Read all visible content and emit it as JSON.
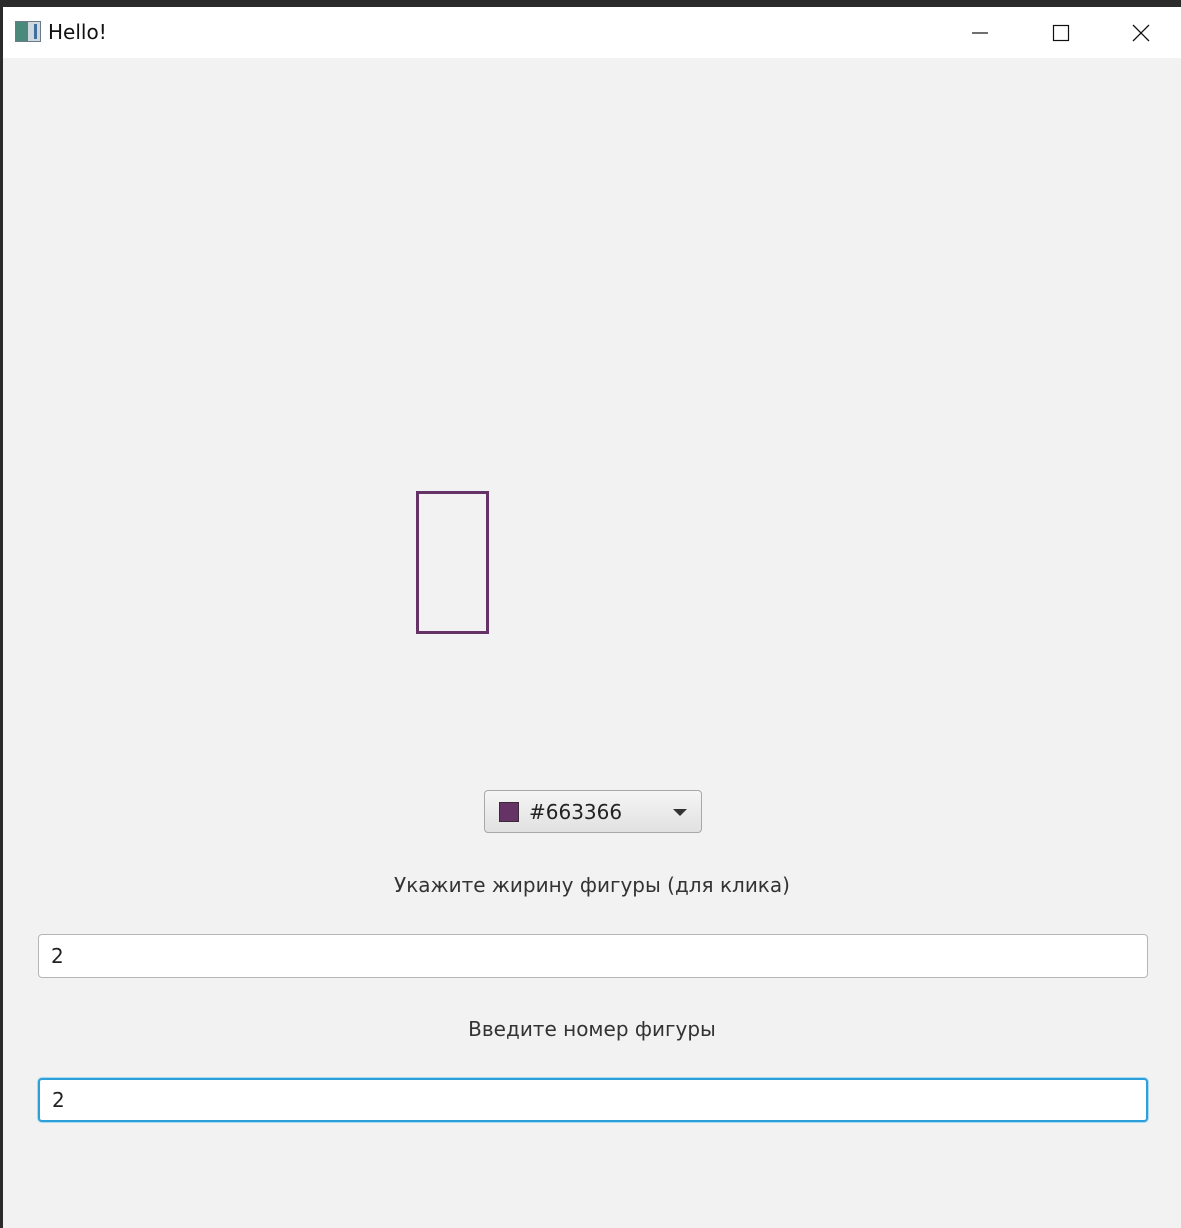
{
  "window": {
    "title": "Hello!"
  },
  "color_picker": {
    "value": "#663366",
    "swatch_color": "#663366",
    "dropdown_icon": "chevron-down-icon"
  },
  "shape": {
    "type": "rectangle",
    "stroke_color": "#663366"
  },
  "stroke_width": {
    "label": "Укажите жирину фигуры (для клика)",
    "value": "2"
  },
  "shape_number": {
    "label": "Введите номер фигуры",
    "value": "2"
  }
}
